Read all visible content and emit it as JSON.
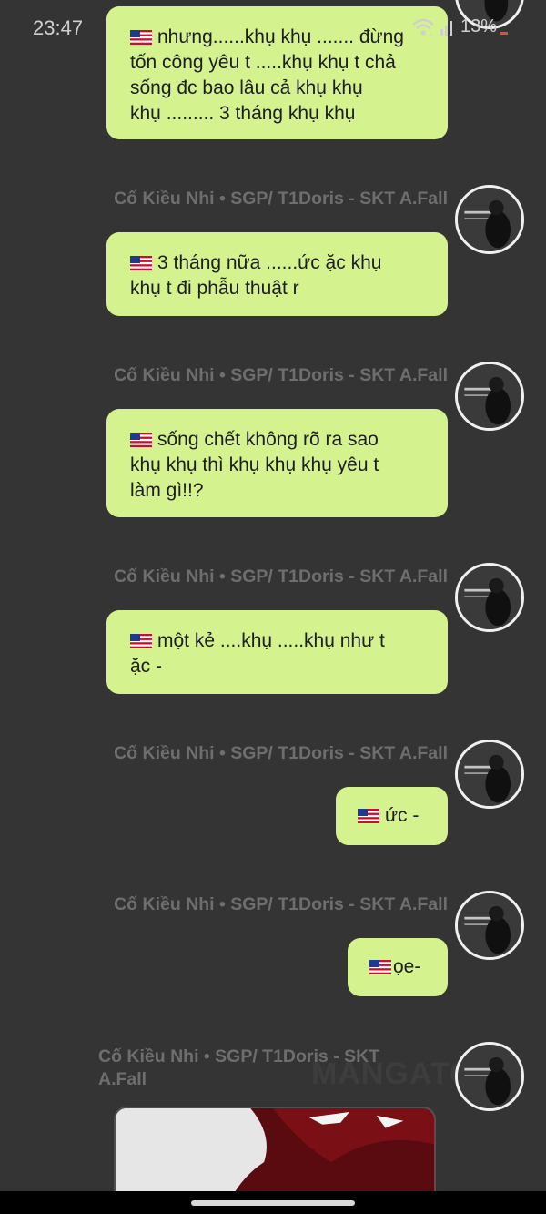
{
  "status_bar": {
    "time": "23:47",
    "battery": "13%",
    "icons": [
      "wifi-icon",
      "signal-icon",
      "battery-icon"
    ]
  },
  "sender_name": "Cố Kiều Nhi • SGP/ T1Doris - SKT A.Fall",
  "flag_icon": "us-flag-icon",
  "bubble_color": "#d4f28e",
  "background_color": "#343434",
  "messages": [
    {
      "text": "nhưng......khụ khụ ....... đừng\ntốn công yêu t .....khụ khụ t chả\nsống đc bao lâu cả khụ khụ\nkhụ ......... 3 tháng khụ khụ"
    },
    {
      "text": "3 tháng nữa ......ức ặc khụ\nkhụ t đi phẫu thuật r"
    },
    {
      "text": "sống chết không rõ ra sao\nkhụ khụ thì khụ khụ khụ yêu t\nlàm gì!!?"
    },
    {
      "text": "một kẻ ....khụ .....khụ như t\nặc -"
    },
    {
      "text": "ức -"
    },
    {
      "text": "ọe-"
    }
  ],
  "watermark": "MANGATO"
}
